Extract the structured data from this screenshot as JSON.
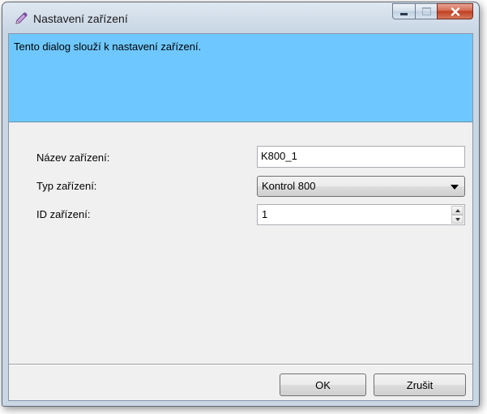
{
  "window": {
    "title": "Nastavení zařízení"
  },
  "info": {
    "text": "Tento dialog slouží k nastavení zařízení."
  },
  "form": {
    "name_label": "Název zařízení:",
    "name_value": "K800_1",
    "type_label": "Typ zařízení:",
    "type_value": "Kontrol 800",
    "id_label": "ID zařízení:",
    "id_value": "1"
  },
  "buttons": {
    "ok": "OK",
    "cancel": "Zrušit"
  },
  "colors": {
    "info_panel": "#6ec8ff",
    "close_button": "#c13f22",
    "dialog_background": "#f0f0f0"
  },
  "icons": [
    "pencil-icon",
    "minimize-icon",
    "maximize-icon",
    "close-icon",
    "dropdown-arrow-icon",
    "spin-up-icon",
    "spin-down-icon"
  ]
}
